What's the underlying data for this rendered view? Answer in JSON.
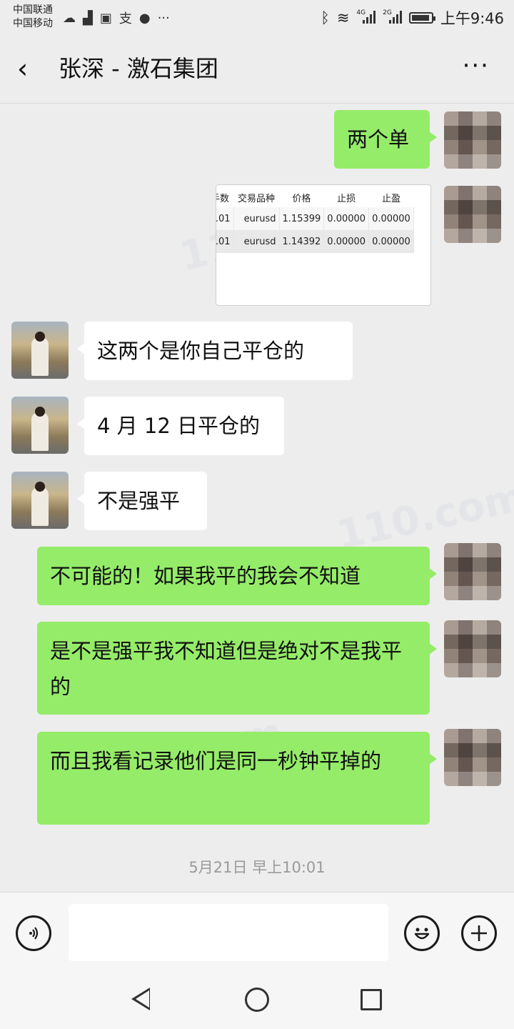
{
  "status_bar": {
    "carrier1": "中国联通",
    "carrier2": "中国移动",
    "net1": "4G",
    "net2": "2G",
    "time": "上午9:46"
  },
  "header": {
    "title": "张深 - 激石集团"
  },
  "messages": [
    {
      "text": "两个单"
    },
    {
      "text": "这两个是你自己平仓的"
    },
    {
      "text": "4 月 12 日平仓的"
    },
    {
      "text": "不是强平"
    },
    {
      "text": "不可能的！如果我平的我会不知道"
    },
    {
      "text": "是不是强平我不知道但是绝对不是我平的"
    },
    {
      "text": "而且我看记录他们是同一秒钟平掉的"
    }
  ],
  "image_table": {
    "headers": [
      "手数",
      "交易品种",
      "价格",
      "止损",
      "止盈"
    ],
    "rows": [
      [
        ".01",
        "eurusd",
        "1.15399",
        "0.00000",
        "0.00000"
      ],
      [
        ".01",
        "eurusd",
        "1.14392",
        "0.00000",
        "0.00000"
      ]
    ]
  },
  "timestamp": "5月21日 早上10:01",
  "watermark": "110.com",
  "colors": {
    "my_bubble": "#95ec69",
    "their_bubble": "#ffffff",
    "background": "#ededed"
  }
}
